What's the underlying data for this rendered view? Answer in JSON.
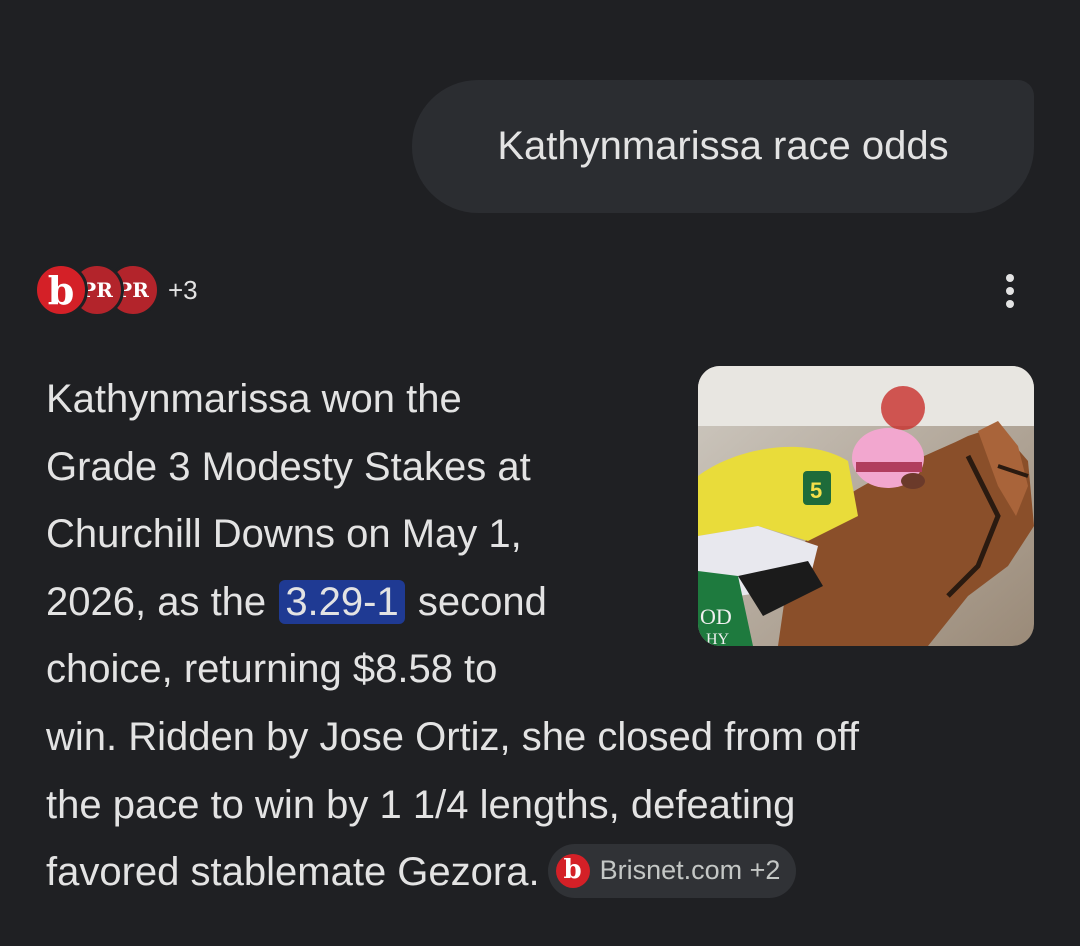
{
  "query": {
    "text": "Kathynmarissa race odds"
  },
  "sources": {
    "logos": [
      {
        "name": "b",
        "color": "#d42027"
      },
      {
        "name": "PR",
        "color": "#b3242b"
      },
      {
        "name": "PR",
        "color": "#b3242b"
      }
    ],
    "more_count": "+3"
  },
  "answer": {
    "lines": [
      "Kathynmarissa won the",
      "Grade 3 Modesty Stakes at",
      "Churchill Downs on May 1,",
      "2026, as the",
      "second",
      "choice, returning $8.58 to",
      "win. Ridden by Jose Ortiz, she closed from off",
      "the pace to win by 1 1/4 lengths, defeating",
      "favored stablemate Gezora."
    ],
    "highlight": "3.29-1"
  },
  "citation": {
    "logo": "b",
    "label": "Brisnet.com +2"
  },
  "photo": {
    "saddle_cloth_number": "5",
    "banner_text_1": "OD",
    "banner_text_2": "HY"
  },
  "colors": {
    "background": "#1f2023",
    "bubble": "#2b2d31",
    "highlight": "#1f3a93",
    "brand_red": "#d42027"
  }
}
